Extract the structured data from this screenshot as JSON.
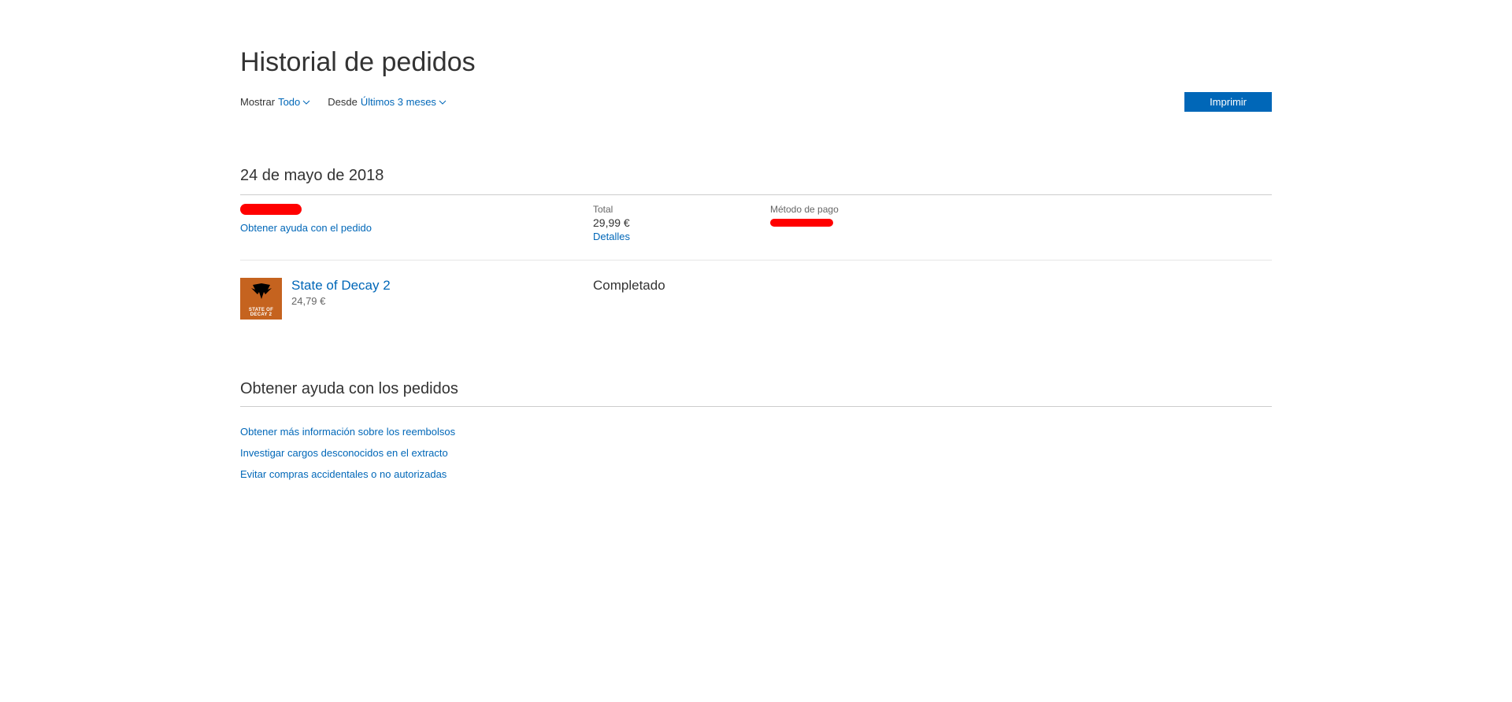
{
  "page": {
    "title": "Historial de pedidos"
  },
  "filters": {
    "show_label": "Mostrar",
    "show_value": "Todo",
    "since_label": "Desde",
    "since_value": "Últimos 3 meses"
  },
  "actions": {
    "print_label": "Imprimir"
  },
  "order": {
    "date": "24 de mayo de 2018",
    "help_link": "Obtener ayuda con el pedido",
    "total_label": "Total",
    "total_value": "29,99 €",
    "details_link": "Detalles",
    "payment_label": "Método de pago",
    "item": {
      "title": "State of Decay 2",
      "price": "24,79 €",
      "status": "Completado",
      "thumb_line1": "STATE OF",
      "thumb_line2": "DECAY 2"
    }
  },
  "help": {
    "heading": "Obtener ayuda con los pedidos",
    "links": [
      "Obtener más información sobre los reembolsos",
      "Investigar cargos desconocidos en el extracto",
      "Evitar compras accidentales o no autorizadas"
    ]
  }
}
